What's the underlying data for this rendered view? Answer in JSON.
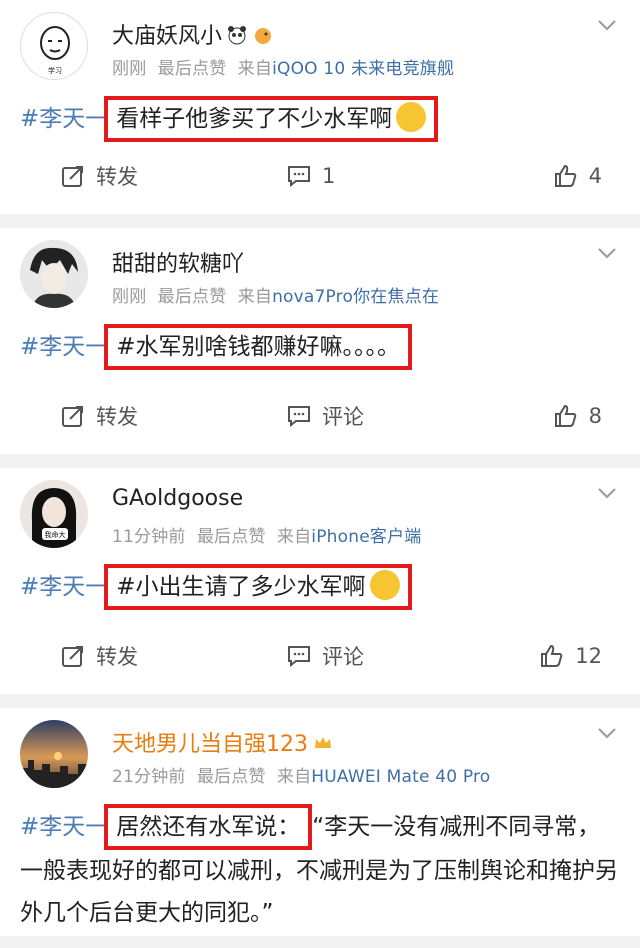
{
  "posts": [
    {
      "username": "大庙妖风小",
      "time": "刚刚",
      "last_like": "最后点赞",
      "source": "来自",
      "device": "iQOO 10 未来电竞旗舰",
      "hashtag": "#李天一",
      "text": "看样子他爹买了不少水军啊",
      "repost": "转发",
      "comment": "1",
      "likes": "4"
    },
    {
      "username": "甜甜的软糖吖",
      "time": "刚刚",
      "last_like": "最后点赞",
      "source": "来自",
      "device": "nova7Pro你在焦点在",
      "hashtag": "#李天一",
      "text": "#水军别啥钱都赚好嘛。。。。",
      "repost": "转发",
      "comment": "评论",
      "likes": "8"
    },
    {
      "username": "GAoldgoose",
      "time": "11分钟前",
      "last_like": "最后点赞",
      "source": "来自",
      "device": "iPhone客户端",
      "hashtag": "#李天一",
      "text": "#小出生请了多少水军啊",
      "repost": "转发",
      "comment": "评论",
      "likes": "12"
    },
    {
      "username": "天地男儿当自强123",
      "time": "21分钟前",
      "last_like": "最后点赞",
      "source": "来自",
      "device": "HUAWEI Mate 40 Pro",
      "hashtag": "#李天一",
      "text": "居然还有水军说：",
      "continuation": "“李天一没有减刑不同寻常，一般表现好的都可以减刑，不减刑是为了压制舆论和掩护另外几个后台更大的同犯。”"
    }
  ],
  "avatar3_text": "我命大",
  "colors": {
    "highlight": "#e31a1a",
    "hashtag": "#4a7cb5",
    "vip_name": "#ea7b0e"
  }
}
